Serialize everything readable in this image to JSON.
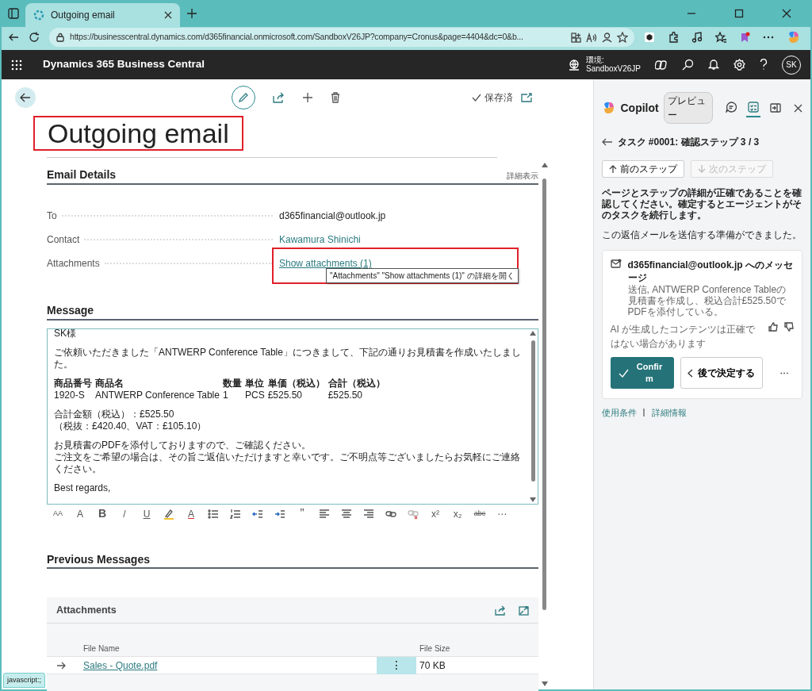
{
  "browser": {
    "tab": {
      "title": "Outgoing email",
      "selected": true
    },
    "url": "https://businesscentral.dynamics.com/d365financial.onmicrosoft.com/SandboxV26JP?company=Cronus&page=4404&dc=0&b..."
  },
  "app_bar": {
    "title": "Dynamics 365 Business Central",
    "environment_label": "環境:",
    "environment_name": "SandboxV26JP",
    "avatar": "SK"
  },
  "page": {
    "title": "Outgoing email",
    "title_highlighted": true,
    "save_status": "保存済"
  },
  "email_details": {
    "heading": "Email Details",
    "show_more": "詳細表示",
    "fields": [
      {
        "label": "To",
        "value": "d365financial@outlook.jp",
        "kind": "text",
        "highlighted": false
      },
      {
        "label": "Contact",
        "value": "Kawamura Shinichi",
        "kind": "link",
        "highlighted": false
      },
      {
        "label": "Attachments",
        "value": "Show attachments (1)",
        "kind": "underlined-link",
        "highlighted": true
      }
    ],
    "tooltip": "\"Attachments\" \"Show attachments (1)\" の詳細を開く"
  },
  "message": {
    "heading": "Message",
    "blocks": [
      {
        "kind": "text",
        "lines": [
          "SK様"
        ]
      },
      {
        "kind": "text",
        "lines": [
          "ご依頼いただきました「ANTWERP Conference Table」につきまして、下記の通りお見積書を作成いたしました。"
        ]
      },
      {
        "kind": "table",
        "header": [
          "商品番号",
          "商品名",
          "数量",
          "単位",
          "単価（税込）",
          "合計（税込）"
        ],
        "rows": [
          [
            "1920-S",
            "ANTWERP Conference Table",
            "1",
            "PCS",
            "£525.50",
            "£525.50"
          ]
        ]
      },
      {
        "kind": "text",
        "lines": [
          "合計金額（税込）：£525.50",
          "（税抜：£420.40、VAT：£105.10）"
        ]
      },
      {
        "kind": "text",
        "lines": [
          "お見積書のPDFを添付しておりますので、ご確認ください。",
          "ご注文をご希望の場合は、その旨ご返信いただけますと幸いです。ご不明点等ございましたらお気軽にご連絡ください。"
        ]
      },
      {
        "kind": "text",
        "lines": [
          "Best regards,"
        ]
      }
    ],
    "toolbar": [
      {
        "kind": "font-size",
        "glyph": "AA",
        "disabled": false
      },
      {
        "kind": "grow-font",
        "glyph": "A",
        "disabled": false
      },
      {
        "kind": "bold",
        "glyph": "B",
        "disabled": false
      },
      {
        "kind": "italic",
        "glyph": "/",
        "disabled": false
      },
      {
        "kind": "underline",
        "glyph": "U",
        "disabled": false
      },
      {
        "kind": "highlight",
        "disabled": false
      },
      {
        "kind": "font-color",
        "glyph": "A",
        "disabled": false
      },
      {
        "kind": "bullets",
        "disabled": false
      },
      {
        "kind": "numbering",
        "disabled": false
      },
      {
        "kind": "outdent",
        "disabled": false
      },
      {
        "kind": "indent",
        "disabled": false
      },
      {
        "kind": "quote",
        "glyph": "”",
        "disabled": false
      },
      {
        "kind": "align-left",
        "disabled": false
      },
      {
        "kind": "align-center",
        "disabled": false
      },
      {
        "kind": "align-right",
        "disabled": false
      },
      {
        "kind": "link",
        "disabled": false
      },
      {
        "kind": "unlink",
        "disabled": true
      },
      {
        "kind": "superscript",
        "glyph": "x²",
        "disabled": false
      },
      {
        "kind": "subscript",
        "glyph": "x₂",
        "disabled": false
      },
      {
        "kind": "strikethrough",
        "glyph": "abc",
        "disabled": false
      },
      {
        "kind": "more",
        "glyph": "⋯",
        "disabled": false
      }
    ]
  },
  "previous_messages": {
    "heading": "Previous Messages"
  },
  "attachments": {
    "heading": "Attachments",
    "columns": [
      "File Name",
      "File Size"
    ],
    "rows": [
      {
        "file_name": "Sales - Quote.pdf",
        "file_size": "70 KB",
        "menu": "⋮"
      }
    ]
  },
  "copilot": {
    "title": "Copilot",
    "badge": "プレビュー",
    "tabs": [
      {
        "kind": "chat",
        "selected": false
      },
      {
        "kind": "tasks",
        "selected": true
      }
    ],
    "task_title": "タスク #0001: 確認ステップ 3 / 3",
    "steps": [
      {
        "label": "前のステップ",
        "kind": "previous",
        "disabled": false
      },
      {
        "label": "次のステップ",
        "kind": "next",
        "disabled": true
      }
    ],
    "instruction": "ページとステップの詳細が正確であることを確認してください。確定するとエージェントがそのタスクを続行します。",
    "status": "この返信メールを送信する準備ができました。",
    "card": {
      "title": "d365financial@outlook.jp へのメッセージ",
      "description": "送信, ANTWERP Conference Tableの見積書を作成し、税込合計£525.50でPDFを添付している。",
      "disclaimer": "AI が生成したコンテンツは正確ではない場合があります",
      "actions": [
        {
          "label": "Confirm",
          "kind": "primary"
        },
        {
          "label": "後で決定する",
          "kind": "secondary"
        }
      ],
      "more": "⋯"
    },
    "footer_links": [
      "使用条件",
      "詳細情報"
    ],
    "footer_separator": "|"
  },
  "status_bar": "javascript:;"
}
